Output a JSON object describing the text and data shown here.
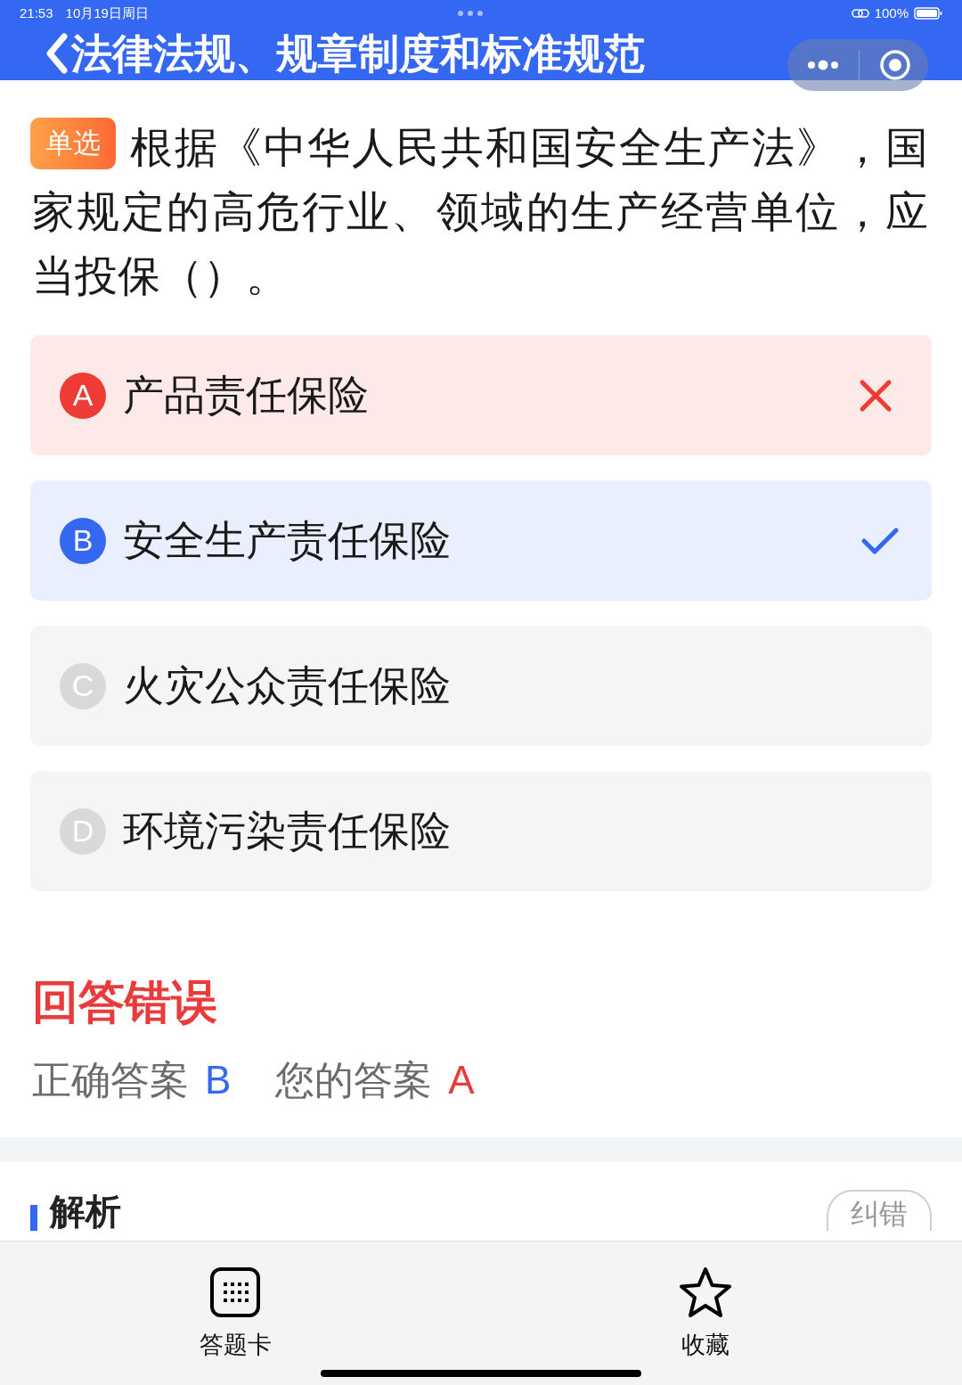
{
  "status_bar": {
    "time": "21:53",
    "date": "10月19日周日",
    "battery": "100%"
  },
  "header": {
    "title": "法律法规、规章制度和标准规范"
  },
  "question": {
    "type_badge": "单选",
    "text": "根据《中华人民共和国安全生产法》，国家规定的高危行业、领域的生产经营单位，应当投保（）。"
  },
  "options": [
    {
      "letter": "A",
      "text": "产品责任保险",
      "selected": true,
      "correct": false
    },
    {
      "letter": "B",
      "text": "安全生产责任保险",
      "selected": false,
      "correct": true
    },
    {
      "letter": "C",
      "text": "火灾公众责任保险",
      "selected": false,
      "correct": false
    },
    {
      "letter": "D",
      "text": "环境污染责任保险",
      "selected": false,
      "correct": false
    }
  ],
  "result": {
    "title": "回答错误",
    "correct_label": "正确答案",
    "correct_answer": "B",
    "your_label": "您的答案",
    "your_answer": "A"
  },
  "analysis": {
    "title": "解析",
    "report_button": "纠错"
  },
  "bottom_bar": [
    {
      "kind": "card",
      "label": "答题卡"
    },
    {
      "kind": "favorite",
      "label": "收藏"
    }
  ]
}
